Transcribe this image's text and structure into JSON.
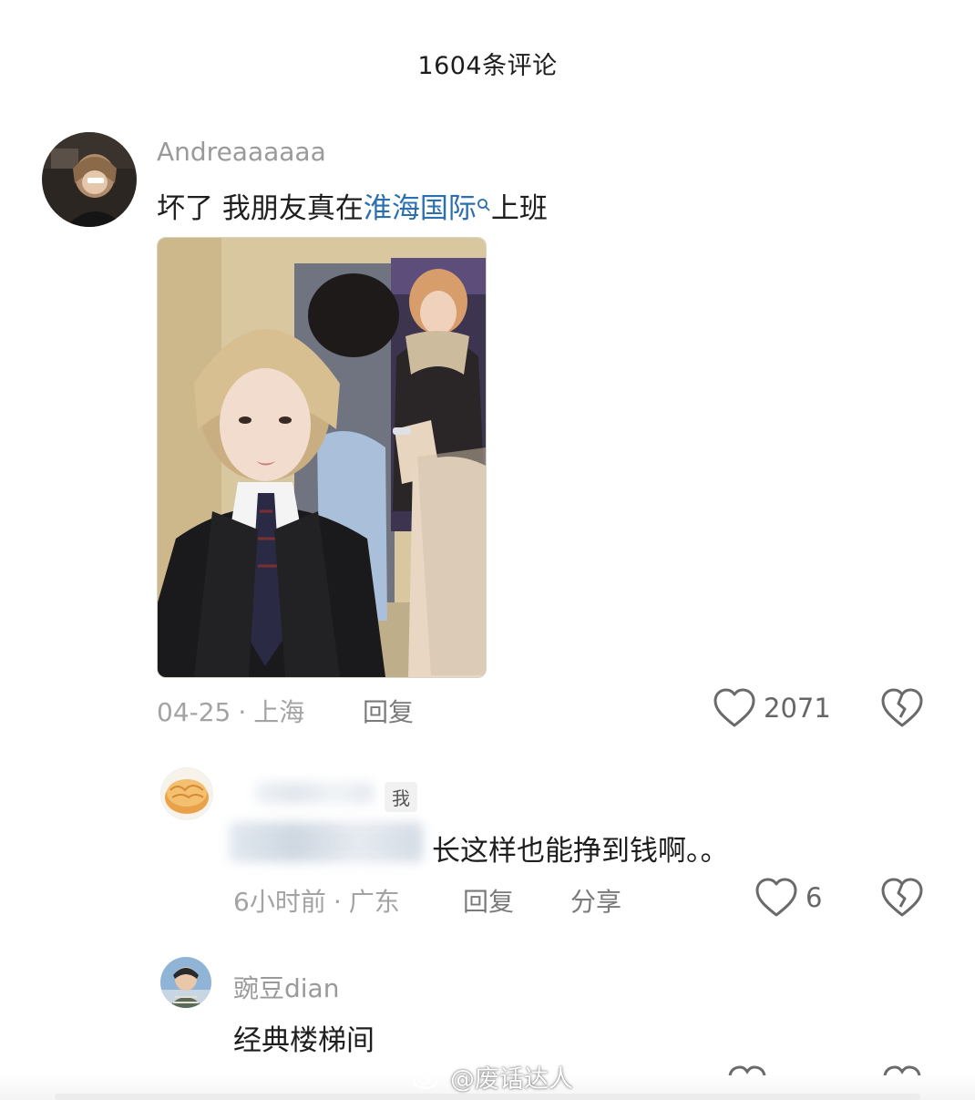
{
  "header": {
    "title": "1604条评论"
  },
  "comments": [
    {
      "username": "Andreaaaaaa",
      "text_before": "坏了 我朋友真在",
      "link_text": "淮海国际",
      "text_after": "上班",
      "date": "04-25",
      "location": "上海",
      "reply_label": "回复",
      "likes": "2071"
    },
    {
      "badge": "我",
      "text_visible": "长这样也能挣到钱啊。。",
      "date": "6小时前",
      "location": "广东",
      "reply_label": "回复",
      "share_label": "分享",
      "likes": "6"
    },
    {
      "username": "豌豆dian",
      "text": "经典楼梯间"
    }
  ],
  "meta_separator": "·",
  "watermark": {
    "text": "@废话达人"
  },
  "colors": {
    "link": "#2b6fb0",
    "muted": "#a3a3a3",
    "text": "#1e1e1e"
  },
  "icons": {
    "like": "heart-outline-icon",
    "dislike": "broken-heart-icon",
    "search": "search-icon"
  }
}
